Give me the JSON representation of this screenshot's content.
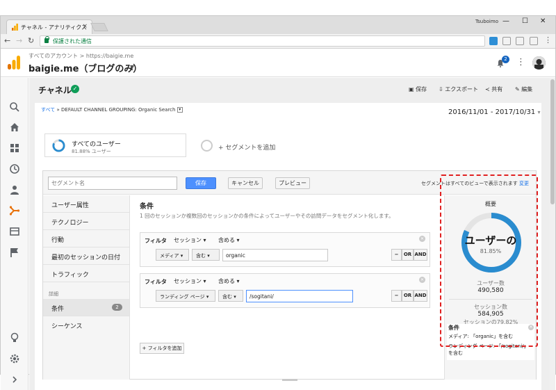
{
  "browser": {
    "tab_title": "チャネル - アナリティクス",
    "tab_close": "×",
    "user_name": "Tsuboimo",
    "address": "保護された通信",
    "win_minimize": "—",
    "win_maximize": "☐",
    "win_close": "✕"
  },
  "header": {
    "account_path": "すべてのアカウント > https://baigie.me",
    "property": "baigie.me（ブログのみ）",
    "notification_count": "2"
  },
  "page": {
    "title": "チャネル",
    "actions": {
      "save": "保存",
      "export": "エクスポート",
      "share": "共有",
      "edit": "編集"
    },
    "breadcrumb_all": "すべて",
    "breadcrumb_sep": "»",
    "breadcrumb_rest": "DEFAULT CHANNEL GROUPING: Organic Search",
    "date_range": "2016/11/01 - 2017/10/31",
    "segment": {
      "title": "すべてのユーザー",
      "sub": "81.88% ユーザー"
    },
    "add_segment": "+ セグメントを追加"
  },
  "editor": {
    "name_placeholder": "セグメント名",
    "save": "保存",
    "cancel": "キャンセル",
    "preview": "プレビュー",
    "note": "セグメントはすべてのビューで表示されます",
    "note_change": "変更",
    "sidebar": {
      "items": [
        "ユーザー属性",
        "テクノロジー",
        "行動",
        "最初のセッションの日付",
        "トラフィック"
      ],
      "advanced_label": "詳細",
      "conditions": "条件",
      "conditions_count": "2",
      "sequences": "シーケンス"
    },
    "conditions_title": "条件",
    "conditions_desc": "1 回のセッションか複数回のセッションかの条件によってユーザーやその訪問データをセグメント化します。",
    "filters": [
      {
        "label": "フィルタ",
        "scope": "セッション",
        "mode": "含める",
        "dimension": "メディア",
        "operator": "含む",
        "value": "organic"
      },
      {
        "label": "フィルタ",
        "scope": "セッション",
        "mode": "含める",
        "dimension": "ランディング ページ",
        "operator": "含む",
        "value": "/sogitani/"
      }
    ],
    "op_minus": "−",
    "op_or": "OR",
    "op_and": "AND",
    "add_filter": "+ フィルタを追加"
  },
  "summary": {
    "title": "概要",
    "ring_text": "ユーザーの",
    "ring_pct": "81.85%",
    "users_label": "ユーザー数",
    "users_value": "490,580",
    "sessions_label": "セッション数",
    "sessions_value": "584,905",
    "sessions_pct": "セッションの79.82%",
    "cond_title": "条件",
    "cond_line1": "メディア: 「organic」を含む",
    "cond_line2": "ランディング ページ: 「/sogitani/」を含む",
    "ring_fill": 0.8185
  },
  "colors": {
    "accent_blue": "#4d90fe",
    "ring_blue": "#2a8ccf",
    "highlight_red": "#e02020",
    "nav_active": "#e8710a"
  }
}
